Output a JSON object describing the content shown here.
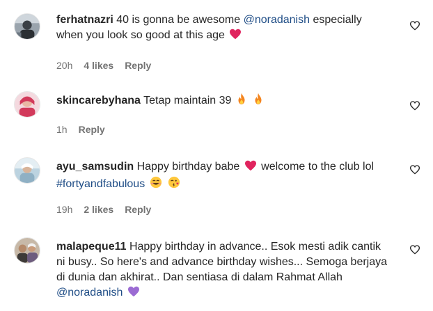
{
  "comments": [
    {
      "username": "ferhatnazri",
      "text_before": " 40 is gonna be awesome ",
      "mention": "@noradanish",
      "text_after": " especially when you look so good at this age",
      "emoji": "red-heart",
      "time": "20h",
      "likes": "4 likes",
      "reply": "Reply"
    },
    {
      "username": "skincarebyhana",
      "text_before": " Tetap maintain 39",
      "emoji": "fire",
      "time": "1h",
      "reply": "Reply"
    },
    {
      "username": "ayu_samsudin",
      "text_before": " Happy birthday babe",
      "text_middle": " welcome to the club lol ",
      "hashtag": "#fortyandfabulous",
      "emoji": "red-heart",
      "time": "19h",
      "likes": "2 likes",
      "reply": "Reply"
    },
    {
      "username": "malapeque11",
      "text_before": " Happy birthday in advance.. Esok mesti adik cantik ni busy.. So here's and advance birthday wishes... Semoga berjaya di dunia dan akhirat.. Dan sentiasa di dalam Rahmat Allah ",
      "mention": "@noradanish",
      "emoji": "purple-heart"
    }
  ],
  "colors": {
    "text": "#262626",
    "secondary": "#737373",
    "link": "#1f4d86",
    "red_heart": "#e0245e",
    "purple_heart": "#9b6bd3",
    "fire": "#f4851f"
  }
}
